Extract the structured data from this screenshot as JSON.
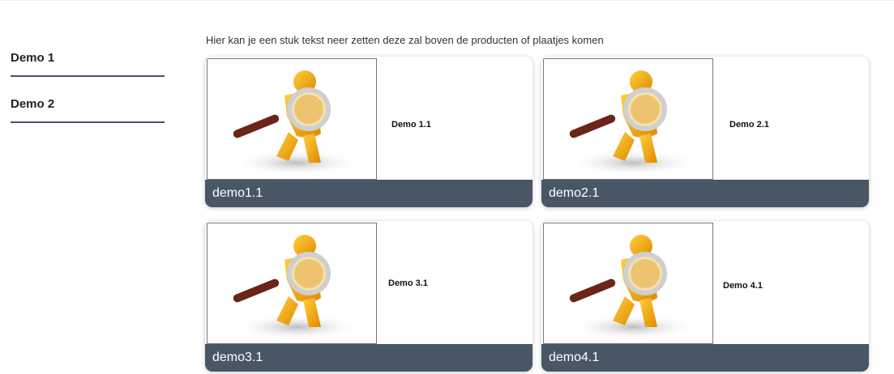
{
  "sidebar": {
    "items": [
      {
        "label": "Demo 1"
      },
      {
        "label": "Demo 2"
      }
    ]
  },
  "intro": {
    "text": "Hier kan je een stuk tekst neer zetten deze zal boven de producten of plaatjes komen"
  },
  "cards": [
    {
      "subtitle": "Demo 1.1",
      "caption": "demo1.1"
    },
    {
      "subtitle": "Demo 2.1",
      "caption": "demo2.1"
    },
    {
      "subtitle": "Demo 3.1",
      "caption": "demo3.1"
    },
    {
      "subtitle": "Demo 4.1",
      "caption": "demo4.1"
    }
  ],
  "colors": {
    "footer": "#485666",
    "sidebar_underline": "#4a5566",
    "figure": "#f5a916",
    "handle": "#6b2418"
  },
  "icons": {
    "card_image": "magnifier-figure-icon"
  }
}
